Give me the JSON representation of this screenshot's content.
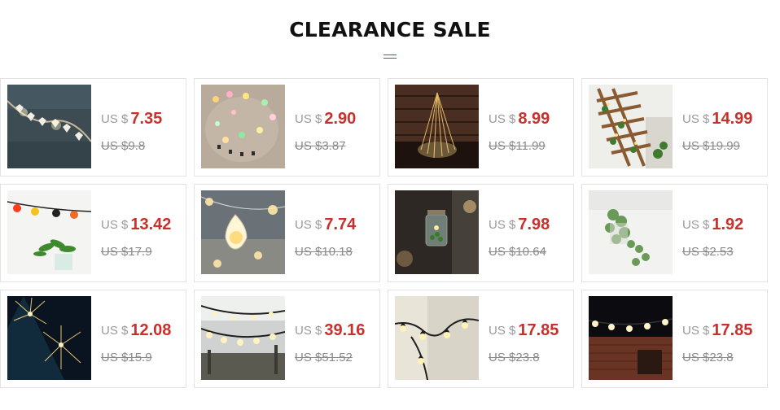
{
  "section": {
    "title": "CLEARANCE SALE"
  },
  "products": [
    {
      "currency": "US $",
      "price": "7.35",
      "old_price": "US $9.8",
      "image": "heart-lights-photo"
    },
    {
      "currency": "US $",
      "price": "2.90",
      "old_price": "US $3.87",
      "image": "pastel-lights-photo"
    },
    {
      "currency": "US $",
      "price": "8.99",
      "old_price": "US $11.99",
      "image": "waterfall-lights-photo"
    },
    {
      "currency": "US $",
      "price": "14.99",
      "old_price": "US $19.99",
      "image": "ivy-trellis-lights-photo"
    },
    {
      "currency": "US $",
      "price": "13.42",
      "old_price": "US $17.9",
      "image": "colored-bulbs-photo"
    },
    {
      "currency": "US $",
      "price": "7.74",
      "old_price": "US $10.18",
      "image": "teardrop-lights-photo"
    },
    {
      "currency": "US $",
      "price": "7.98",
      "old_price": "US $10.64",
      "image": "jar-lights-photo"
    },
    {
      "currency": "US $",
      "price": "1.92",
      "old_price": "US $2.53",
      "image": "ivy-vine-photo"
    },
    {
      "currency": "US $",
      "price": "12.08",
      "old_price": "US $15.9",
      "image": "firework-lights-photo"
    },
    {
      "currency": "US $",
      "price": "39.16",
      "old_price": "US $51.52",
      "image": "patio-bulb-string-photo"
    },
    {
      "currency": "US $",
      "price": "17.85",
      "old_price": "US $23.8",
      "image": "star-string-lights-photo"
    },
    {
      "currency": "US $",
      "price": "17.85",
      "old_price": "US $23.8",
      "image": "brick-house-lights-photo"
    }
  ]
}
